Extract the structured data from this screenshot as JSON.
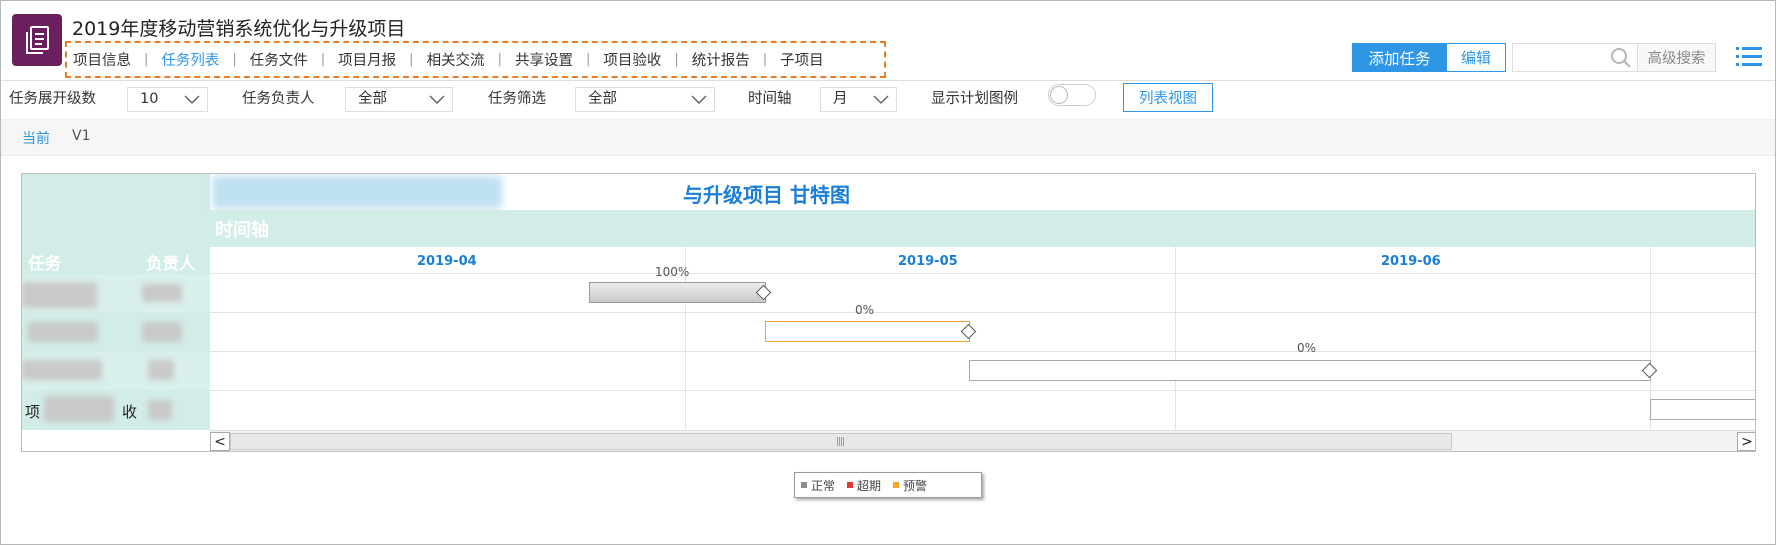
{
  "header": {
    "title": "2019年度移动营销系统优化与升级项目",
    "nav": [
      {
        "label": "项目信息",
        "active": false
      },
      {
        "label": "任务列表",
        "active": true
      },
      {
        "label": "任务文件",
        "active": false
      },
      {
        "label": "项目月报",
        "active": false
      },
      {
        "label": "相关交流",
        "active": false
      },
      {
        "label": "共享设置",
        "active": false
      },
      {
        "label": "项目验收",
        "active": false
      },
      {
        "label": "统计报告",
        "active": false
      },
      {
        "label": "子项目",
        "active": false
      }
    ],
    "add_task_label": "添加任务",
    "edit_label": "编辑",
    "search_placeholder": "",
    "advanced_search_label": "高级搜索",
    "icons": {
      "app": "document-icon",
      "search": "search-icon",
      "menu": "menu-icon"
    }
  },
  "filters": {
    "expand_level_label": "任务展开级数",
    "expand_level_value": "10",
    "owner_label": "任务负责人",
    "owner_value": "全部",
    "task_filter_label": "任务筛选",
    "task_filter_value": "全部",
    "timeaxis_label": "时间轴",
    "timeaxis_value": "月",
    "show_legend_label": "显示计划图例",
    "show_legend_on": false,
    "list_view_label": "列表视图"
  },
  "version": {
    "current_label": "当前",
    "name": "V1"
  },
  "gantt": {
    "title": "与升级项目  甘特图",
    "timeaxis_label": "时间轴",
    "col_task": "任务",
    "col_owner": "负责人",
    "months": [
      "2019-04",
      "2019-05",
      "2019-06"
    ],
    "rows": [
      {
        "task": "",
        "owner": "",
        "progress": "100%"
      },
      {
        "task": "",
        "owner": "",
        "progress": "0%"
      },
      {
        "task": "",
        "owner": "",
        "progress": "0%"
      },
      {
        "task_prefix": "项",
        "task_suffix": "收",
        "owner": "",
        "progress": ""
      }
    ]
  },
  "legend": {
    "items": [
      {
        "label": "正常",
        "color": "#8c8c8c"
      },
      {
        "label": "超期",
        "color": "#e53935"
      },
      {
        "label": "预警",
        "color": "#f4a91f"
      }
    ]
  },
  "colors": {
    "accent": "#2f96e6",
    "nav_highlight": "#ee7a22",
    "app_icon": "#6b1f5f",
    "gantt_header": "#d2ece8"
  }
}
